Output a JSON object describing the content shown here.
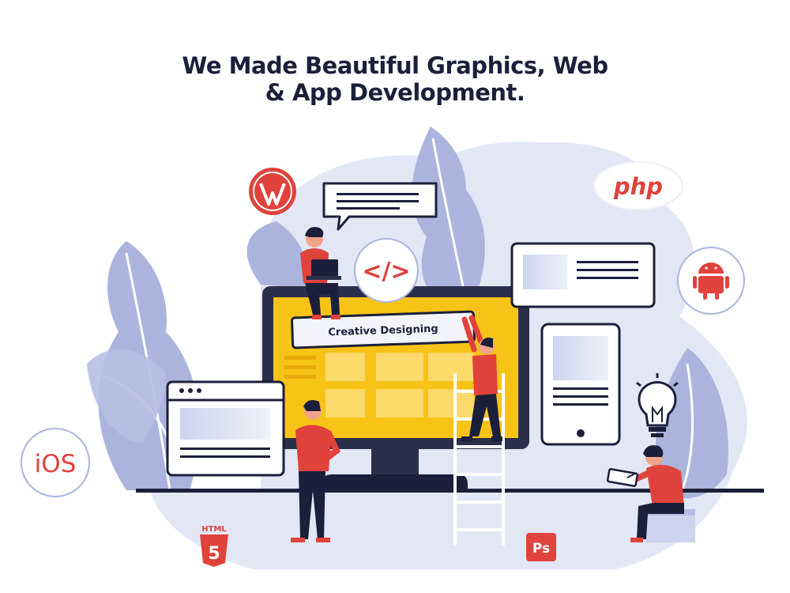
{
  "headline": {
    "line1": "We Made Beautiful Graphics, Web",
    "line2": "& App Development."
  },
  "banner": {
    "text": "Creative Designing"
  },
  "badges": {
    "ios": "iOS",
    "php": "php",
    "ps": "Ps",
    "html": "HTML",
    "html_number": "5",
    "code": "</>"
  },
  "icons": [
    "wordpress-icon",
    "php-icon",
    "android-icon",
    "ios-icon",
    "html5-icon",
    "photoshop-icon",
    "code-icon",
    "lightbulb-icon",
    "speech-bubble-icon"
  ],
  "colors": {
    "accent_red": "#e0423c",
    "navy": "#1c1f3a",
    "blob": "#e3e7f5",
    "leaf": "#aab4dd",
    "screen_yellow": "#f7c316",
    "tile_yellow": "#fbd96a"
  }
}
